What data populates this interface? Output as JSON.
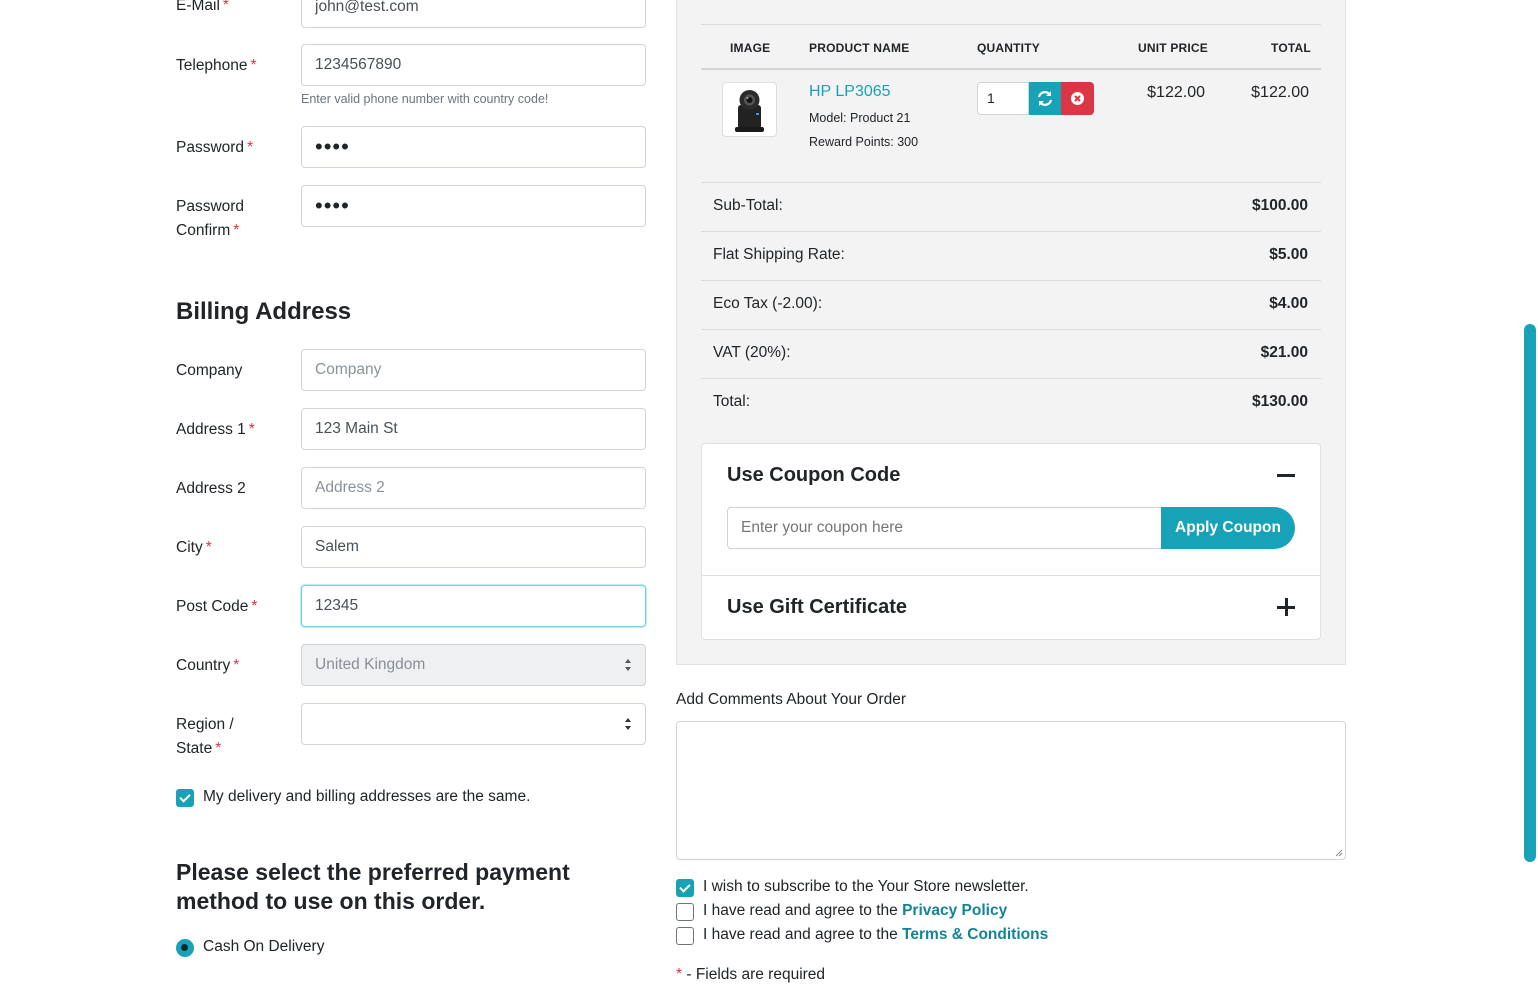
{
  "account": {
    "email": {
      "label": "E-Mail",
      "value": "john@test.com"
    },
    "telephone": {
      "label": "Telephone",
      "value": "1234567890",
      "help": "Enter valid phone number with country code!"
    },
    "password": {
      "label": "Password",
      "value": "••••"
    },
    "password_confirm": {
      "label_line1": "Password",
      "label_line2": "Confirm",
      "value": "••••"
    }
  },
  "billing": {
    "title": "Billing Address",
    "company": {
      "label": "Company",
      "value": "",
      "placeholder": "Company"
    },
    "address1": {
      "label": "Address 1",
      "value": "123 Main St"
    },
    "address2": {
      "label": "Address 2",
      "value": "",
      "placeholder": "Address 2"
    },
    "city": {
      "label": "City",
      "value": "Salem"
    },
    "postcode": {
      "label": "Post Code",
      "value": "12345"
    },
    "country": {
      "label": "Country",
      "value": "United Kingdom"
    },
    "region": {
      "label_line1": "Region /",
      "label_line2": "State",
      "value": ""
    },
    "same_address": {
      "label": "My delivery and billing addresses are the same.",
      "checked": true
    }
  },
  "payment": {
    "title": "Please select the preferred payment method to use on this order.",
    "options": [
      {
        "label": "Cash On Delivery",
        "selected": true
      }
    ]
  },
  "cart": {
    "headers": {
      "image": "IMAGE",
      "name": "PRODUCT NAME",
      "quantity": "QUANTITY",
      "unit_price": "UNIT PRICE",
      "total": "TOTAL"
    },
    "items": [
      {
        "name": "HP LP3065",
        "model": "Model: Product 21",
        "reward": "Reward Points: 300",
        "quantity": "1",
        "unit_price": "$122.00",
        "total": "$122.00"
      }
    ],
    "totals": [
      {
        "label": "Sub-Total:",
        "value": "$100.00"
      },
      {
        "label": "Flat Shipping Rate:",
        "value": "$5.00"
      },
      {
        "label": "Eco Tax (-2.00):",
        "value": "$4.00"
      },
      {
        "label": "VAT (20%):",
        "value": "$21.00"
      },
      {
        "label": "Total:",
        "value": "$130.00"
      }
    ]
  },
  "coupon": {
    "title": "Use Coupon Code",
    "placeholder": "Enter your coupon here",
    "button": "Apply Coupon",
    "expanded": true
  },
  "gift": {
    "title": "Use Gift Certificate",
    "expanded": false
  },
  "comments": {
    "label": "Add Comments About Your Order",
    "value": ""
  },
  "agreements": {
    "newsletter": {
      "label": "I wish to subscribe to the Your Store newsletter.",
      "checked": true
    },
    "privacy": {
      "prefix": "I have read and agree to the ",
      "link": "Privacy Policy",
      "checked": false
    },
    "terms": {
      "prefix": "I have read and agree to the ",
      "link": "Terms & Conditions",
      "checked": false
    }
  },
  "required_note": {
    "star": "*",
    "text": " - Fields are required"
  },
  "colors": {
    "accent": "#17a2b8",
    "danger": "#dc3545",
    "required": "#dc3545"
  }
}
